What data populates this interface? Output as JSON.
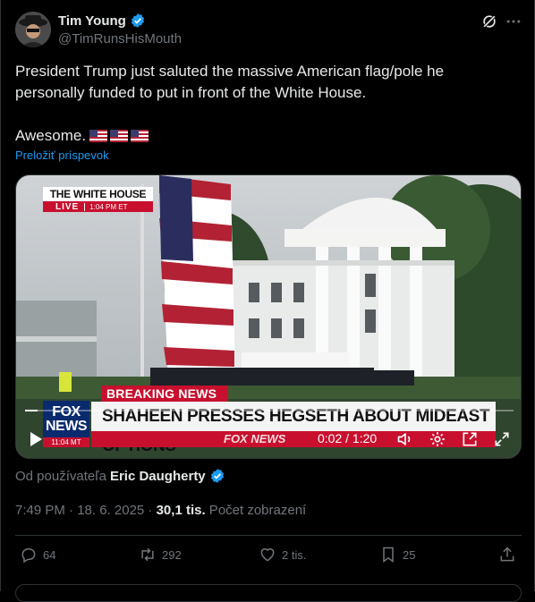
{
  "author": {
    "name": "Tim Young",
    "handle": "@TimRunsHisMouth"
  },
  "tweet": {
    "line1": "President Trump just saluted the massive American flag/pole he personally funded to put in front of the White House.",
    "line2": "Awesome.",
    "translate": "Preložiť príspevok"
  },
  "video": {
    "bug_title": "THE WHITE HOUSE",
    "bug_live": "LIVE",
    "bug_time": "1:04 PM ET",
    "breaking": "BREAKING NEWS",
    "headline": "SHAHEEN PRESSES HEGSETH ABOUT MIDEAST OPTIONS",
    "fox_line1": "FOX",
    "fox_line2": "NEWS",
    "fox_time": "11:04 MT",
    "ticker_brand": "FOX NEWS",
    "time_display": "0:02 / 1:20",
    "progress": 0.025
  },
  "attribution": {
    "prefix": "Od používateľa",
    "name": "Eric Daugherty"
  },
  "meta": {
    "timestamp": "7:49 PM · 18. 6. 2025 · ",
    "views": "30,1 tis.",
    "views_label": " Počet zobrazení"
  },
  "actions": {
    "replies": "64",
    "reposts": "292",
    "likes": "2 tis.",
    "bookmarks": "25"
  },
  "colors": {
    "accent": "#1d9bf0",
    "fox_red": "#c8102e",
    "fox_blue": "#0a2a6e"
  }
}
